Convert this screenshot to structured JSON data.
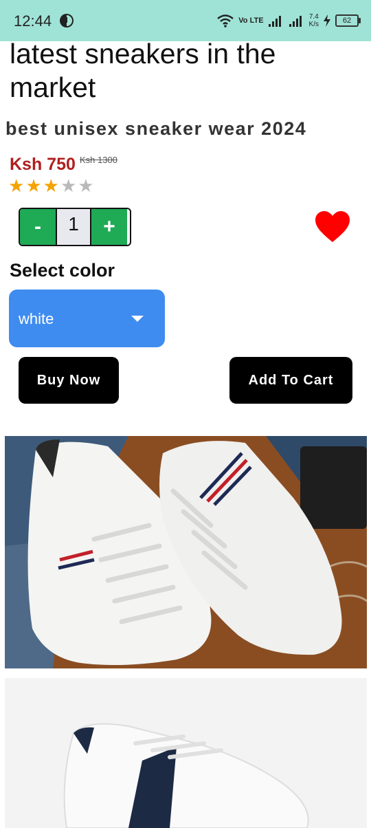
{
  "status_bar": {
    "time": "12:44",
    "network_label": "Vo LTE",
    "speed_value": "7.4",
    "speed_unit": "K/s",
    "battery": "62",
    "icons": [
      "clock-icon",
      "wifi-icon",
      "signal-icon",
      "charging-icon",
      "battery-icon"
    ]
  },
  "product": {
    "title": "latest sneakers in the market",
    "subtitle": "best unisex sneaker wear 2024",
    "price": "Ksh 750",
    "old_price": "Ksh 1300",
    "rating": 3,
    "rating_max": 5
  },
  "quantity": {
    "minus_label": "-",
    "value": "1",
    "plus_label": "+"
  },
  "favorite": {
    "icon": "heart-icon",
    "color": "#ff0000"
  },
  "color_select": {
    "label": "Select color",
    "selected": "white"
  },
  "actions": {
    "buy_now": "Buy Now",
    "add_to_cart": "Add To Cart"
  },
  "colors": {
    "status_bar": "#9fe3d6",
    "price": "#b01e1e",
    "stepper_green": "#1faa55",
    "dropdown_blue": "#3f8cf0",
    "star_on": "#f4a300",
    "star_off": "#b9b9b9"
  },
  "images": {
    "image1": "sneaker-photo-1",
    "image2": "sneaker-photo-2"
  }
}
